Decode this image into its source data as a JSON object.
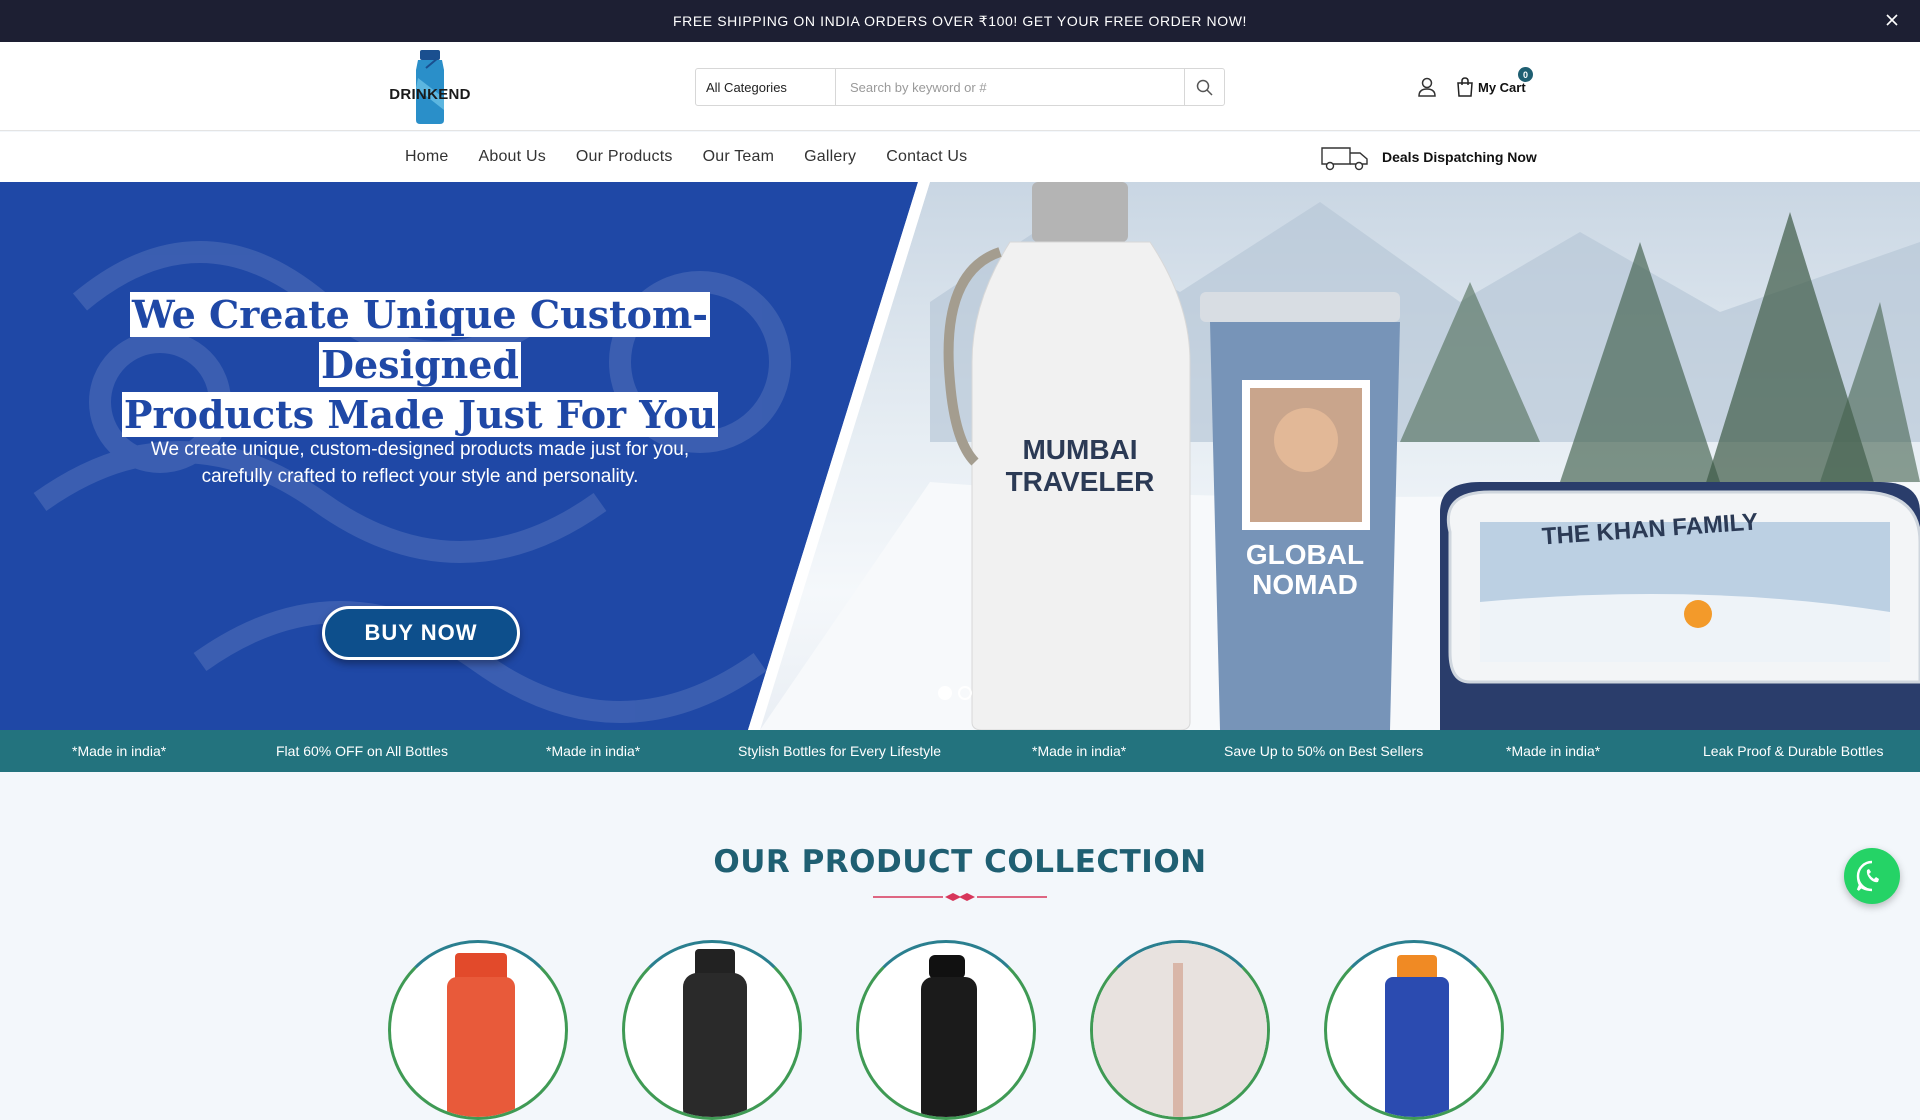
{
  "announcement": {
    "text": "FREE SHIPPING ON INDIA ORDERS OVER ₹100! GET YOUR FREE ORDER NOW!"
  },
  "header": {
    "logo_text": "DRINKEND",
    "search": {
      "category": "All Categories",
      "placeholder": "Search by keyword or #"
    },
    "cart": {
      "label": "My Cart",
      "count": "0"
    }
  },
  "nav": {
    "items": [
      "Home",
      "About Us",
      "Our Products",
      "Our Team",
      "Gallery",
      "Contact Us"
    ],
    "deals_label": "Deals Dispatching Now"
  },
  "hero": {
    "title_line1": "We Create Unique Custom-Designed",
    "title_line2": "Products Made Just For You",
    "subtitle_line1": "We create unique, custom-designed products made just for you,",
    "subtitle_line2": "carefully crafted to reflect your style and personality.",
    "button": "BUY NOW",
    "product_bottle_text_1": "MUMBAI",
    "product_bottle_text_2": "TRAVELER",
    "product_tumbler_text_1": "GLOBAL",
    "product_tumbler_text_2": "NOMAD",
    "product_box_text": "THE KHAN FAMILY",
    "slides": 2,
    "active_slide": 1
  },
  "ticker": {
    "items": [
      "*Made in india*",
      "Flat 60% OFF on All Bottles",
      "*Made in india*",
      "Stylish Bottles for Every Lifestyle",
      "*Made in india*",
      "Save Up to 50% on Best Sellers",
      "*Made in india*",
      "Leak Proof & Durable Bottles"
    ]
  },
  "collection": {
    "title": "OUR PRODUCT COLLECTION"
  },
  "colors": {
    "announce_bg": "#1d1f33",
    "hero_blue": "#1f48a6",
    "ticker_teal": "#23737e",
    "title_teal": "#1f5f72",
    "whatsapp": "#25d366",
    "buy_button": "#0d4f8c"
  }
}
